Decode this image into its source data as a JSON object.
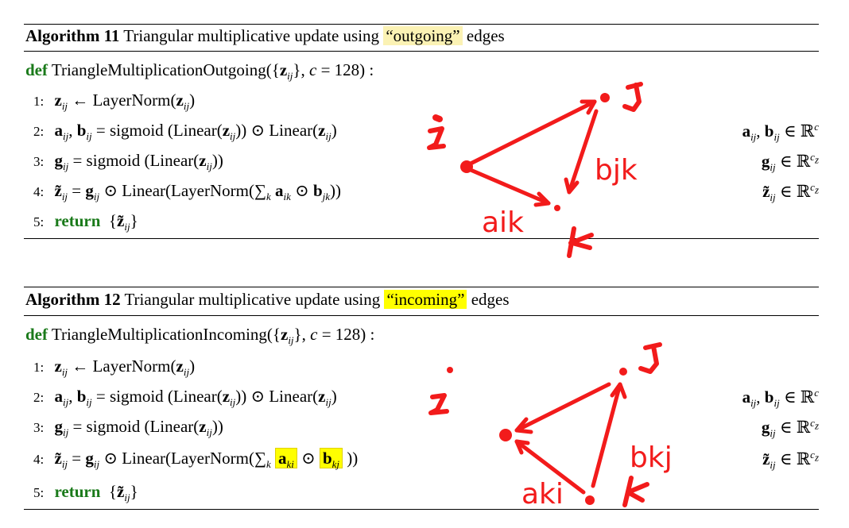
{
  "algorithms": [
    {
      "label": "Algorithm 11",
      "caption_pre": "Triangular multiplicative update using",
      "caption_highlight": "“outgoing”",
      "caption_post": "edges",
      "def_keyword": "def",
      "def_signature": "TriangleMultiplicationOutgoing({zij}, c = 128) :",
      "lines": [
        {
          "num": "1:",
          "text": "zij ← LayerNorm(zij)",
          "right": ""
        },
        {
          "num": "2:",
          "text": "aij, bij = sigmoid (Linear(zij)) ⊙ Linear(zij)",
          "right": "aij, bij ∈ ℝc"
        },
        {
          "num": "3:",
          "text": "gij = sigmoid (Linear(zij))",
          "right": "gij ∈ ℝcz"
        },
        {
          "num": "4:",
          "text": "z̃ij = gij ⊙ Linear(LayerNorm(∑k aik ⊙ bjk))",
          "right": "z̃ij ∈ ℝcz"
        },
        {
          "num": "5:",
          "return_kw": "return",
          "text": "{z̃ij}",
          "right": ""
        }
      ],
      "annotations": {
        "i": "i",
        "j": "j",
        "k": "k",
        "edge1": "bjk",
        "edge2": "aik"
      }
    },
    {
      "label": "Algorithm 12",
      "caption_pre": "Triangular multiplicative update using",
      "caption_highlight": "“incoming”",
      "caption_post": "edges",
      "def_keyword": "def",
      "def_signature": "TriangleMultiplicationIncoming({zij}, c = 128) :",
      "lines": [
        {
          "num": "1:",
          "text": "zij ← LayerNorm(zij)",
          "right": ""
        },
        {
          "num": "2:",
          "text": "aij, bij = sigmoid (Linear(zij)) ⊙ Linear(zij)",
          "right": "aij, bij ∈ ℝc"
        },
        {
          "num": "3:",
          "text": "gij = sigmoid (Linear(zij))",
          "right": "gij ∈ ℝcz"
        },
        {
          "num": "4:",
          "text": "z̃ij = gij ⊙ Linear(LayerNorm(∑k aki ⊙ bkj ))",
          "right": "z̃ij ∈ ℝcz"
        },
        {
          "num": "5:",
          "return_kw": "return",
          "text": "{z̃ij}",
          "right": ""
        }
      ],
      "annotations": {
        "i": "i",
        "j": "j",
        "k": "k",
        "edge1": "bkj",
        "edge2": "aki"
      }
    }
  ],
  "colors": {
    "keyword": "#1a7a1a",
    "annotation": "#f21b1b",
    "highlight_soft": "#fbf2b4",
    "highlight_strong": "#ffff00"
  }
}
